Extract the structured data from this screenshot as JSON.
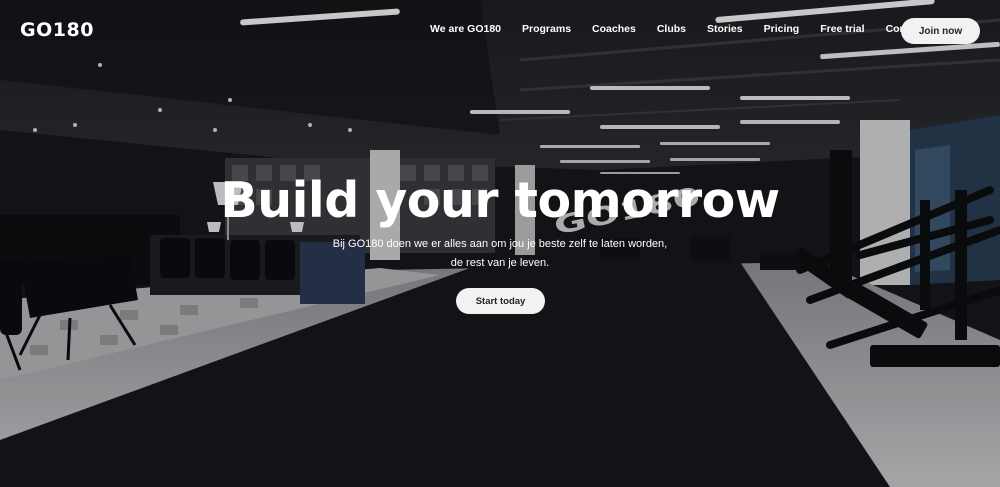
{
  "brand": {
    "logo_text": "GO180"
  },
  "nav": {
    "items": [
      {
        "label": "We are GO180"
      },
      {
        "label": "Programs"
      },
      {
        "label": "Coaches"
      },
      {
        "label": "Clubs"
      },
      {
        "label": "Stories"
      },
      {
        "label": "Pricing"
      },
      {
        "label": "Free trial"
      },
      {
        "label": "Contact"
      }
    ],
    "join_label": "Join now"
  },
  "hero": {
    "headline": "Build your tomorrow",
    "subtitle_line1": "Bij GO180 doen we er alles aan om jou je beste zelf te laten worden,",
    "subtitle_line2": "de rest van je leven.",
    "cta_label": "Start today",
    "floor_logo_text": "GO180"
  },
  "colors": {
    "accent": "#f2f2f2",
    "background": "#15161a",
    "text": "#ffffff"
  }
}
